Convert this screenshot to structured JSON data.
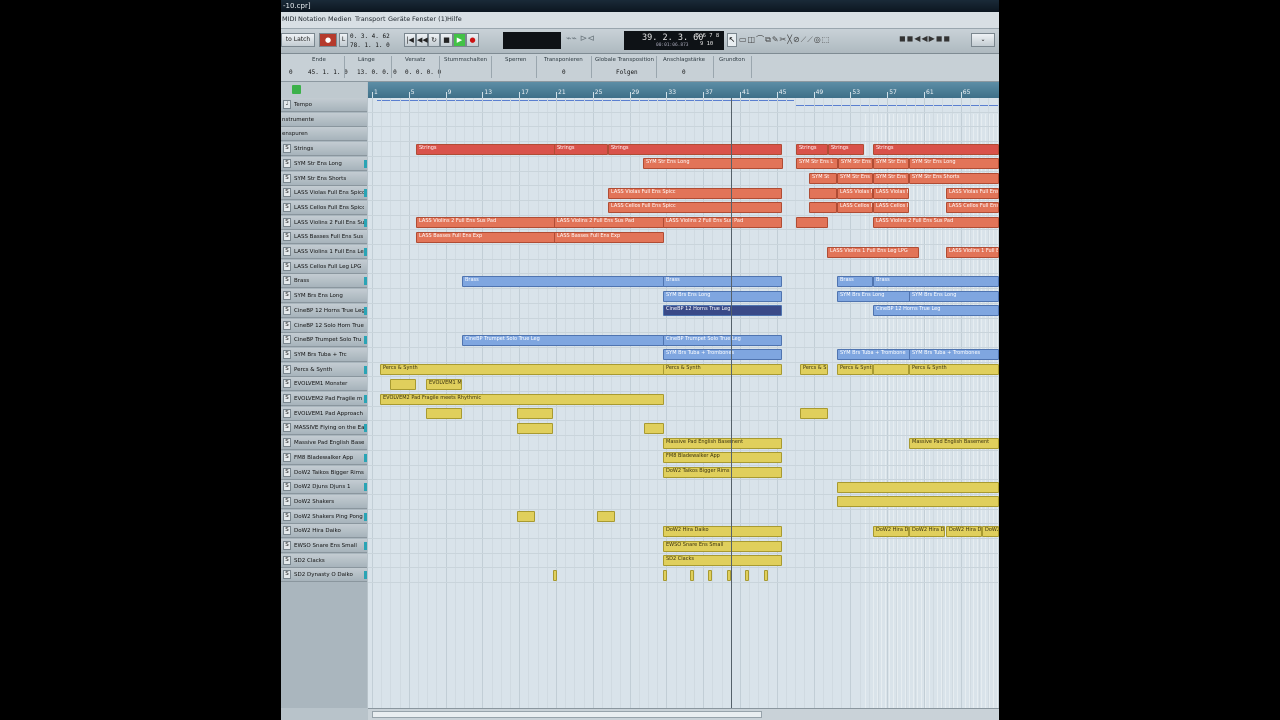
{
  "window_title": "-10.cpr]",
  "menu": [
    "MIDI",
    "Notation",
    "Medien",
    "Transport",
    "Geräte",
    "Fenster (1)",
    "Hilfe"
  ],
  "transport": {
    "mode": "to Latch",
    "loc_left": "0. 3. 4. 62",
    "loc_right": "78. 1. 1. 0",
    "position": "39. 2. 3. 60",
    "position_sub": "00:01:06.873",
    "timesig_top": "5 6 7 8",
    "timesig_bottom": "9 10"
  },
  "info": {
    "labels": [
      "Ende",
      "Länge",
      "Versatz",
      "Stummschalten",
      "Sperren",
      "Transponieren",
      "Globale Transposition",
      "Anschlagstärke",
      "Grundton"
    ],
    "values": [
      "0",
      "45. 1. 1.  0",
      "13. 0. 0.  0",
      "0. 0. 0.  0",
      "",
      "",
      "0",
      "Folgen",
      "0"
    ]
  },
  "colors": {
    "accent": "#5d8ea6",
    "strings": "#e27458",
    "brass": "#7fa6e0",
    "percs": "#e0cf5c"
  },
  "tracks": [
    {
      "name": "Tempo",
      "s": "♩"
    },
    {
      "name": "nstrumente",
      "s": ""
    },
    {
      "name": "enspuren",
      "s": ""
    },
    {
      "name": "Strings",
      "s": "S"
    },
    {
      "name": "SYM Str Ens Long",
      "s": "S"
    },
    {
      "name": "SYM Str Ens Shorts",
      "s": "S"
    },
    {
      "name": "LASS Violas Full Ens Spicc",
      "s": "S"
    },
    {
      "name": "LASS Cellos Full Ens Spicc",
      "s": "S"
    },
    {
      "name": "LASS Violins 2 Full Ens Su",
      "s": "S"
    },
    {
      "name": "LASS Basses Full Ens Sus L",
      "s": "S"
    },
    {
      "name": "LASS Violins 1 Full Ens Le",
      "s": "S"
    },
    {
      "name": "LASS Cellos Full Leg LPG",
      "s": "S"
    },
    {
      "name": "Brass",
      "s": "S"
    },
    {
      "name": "SYM Brs Ens Long",
      "s": "S"
    },
    {
      "name": "CineBP 12 Horns True Leg",
      "s": "S"
    },
    {
      "name": "CineBP 12 Solo Horn True",
      "s": "S"
    },
    {
      "name": "CineBP Trumpet Solo Tru",
      "s": "S"
    },
    {
      "name": "SYM Brs Tuba + Trc",
      "s": "S"
    },
    {
      "name": "Percs & Synth",
      "s": "S"
    },
    {
      "name": "EVOLVEM1 Monster",
      "s": "S"
    },
    {
      "name": "EVOLVEM2 Pad Fragile m",
      "s": "S"
    },
    {
      "name": "EVOLVEM1 Pad Approach",
      "s": "S"
    },
    {
      "name": "MASSIVE Flying on the Ea",
      "s": "S"
    },
    {
      "name": "Massive Pad English Base",
      "s": "S"
    },
    {
      "name": "FM8 Bladewalker App",
      "s": "S"
    },
    {
      "name": "DoW2 Taikos Bigger Rims",
      "s": "S"
    },
    {
      "name": "DoW2 Djuns Djuns 1",
      "s": "S"
    },
    {
      "name": "DoW2 Shakers",
      "s": "S"
    },
    {
      "name": "DoW2 Shakers Ping Pong",
      "s": "S"
    },
    {
      "name": "DoW2 Hira Daiko",
      "s": "S"
    },
    {
      "name": "EWSO Snare Ens Small",
      "s": "S"
    },
    {
      "name": "SD2 Clacks",
      "s": "S"
    },
    {
      "name": "SD2 Dynasty O Daiko",
      "s": "S"
    }
  ],
  "ruler": [
    "1",
    "5",
    "9",
    "13",
    "17",
    "21",
    "25",
    "29",
    "33",
    "37",
    "41",
    "45",
    "49",
    "53",
    "57",
    "61",
    "65"
  ],
  "parts": {
    "strings_1": "Strings",
    "strings_2": "Strings",
    "strings_3": "Strings",
    "strings_4": "Strings",
    "strings_5": "Strings",
    "strings_6": "Strings",
    "symlong_1": "SYM Str Ens Long",
    "symlong_2": "SYM Str Ens L",
    "symlong_3": "SYM Str Ens",
    "symlong_4": "SYM Str Ens",
    "symlong_5": "SYM Str Ens Long",
    "symshort_1": "SYM St",
    "symshort_2": "SYM Str Ens",
    "symshort_3": "SYM Str Ens",
    "symshort_4": "SYM Str Ens Shorts",
    "violas_1": "LASS Violas Full Ens Spicc",
    "violas_2": "LASS Violas F",
    "violas_3": "LASS Violas F",
    "violas_4": "LASS Violas Full Ens",
    "cellos_1": "LASS Cellos Full Ens Spicc",
    "cellos_2": "LASS Cellos F",
    "cellos_3": "LASS Cellos F",
    "cellos_4": "LASS Cellos Full Ens",
    "vln2_1": "LASS Violins 2 Full Ens Sus Pad",
    "vln2_2": "LASS Violins 2 Full Ens Sus Pad",
    "vln2_3": "LASS Violins 2 Full Ens Sus Pad",
    "vln2_4": "LASS Violins 2 Full Ens Sus Pad",
    "bass_1": "LASS Basses Full Ens Exp",
    "bass_2": "LASS Basses Full Ens Exp",
    "vln1_1": "LASS Violins 1 Full Ens Leg LPG",
    "vln1_2": "LASS Violins 1 Full E",
    "brass_1": "Brass",
    "brass_2": "Brass",
    "brass_3": "Brass",
    "brass_4": "Brass",
    "brslong_1": "SYM Brs Ens Long",
    "brslong_2": "SYM Brs Ens Long",
    "brslong_3": "SYM Brs Ens Long",
    "horns_1": "CineBP 12 Horns True Leg",
    "horns_2": "CineBP 12 Horns True Leg",
    "trumpet_1": "CineBP Trumpet Solo True Leg",
    "trumpet_2": "CineBP Trumpet Solo True Leg",
    "tuba_1": "SYM Brs Tuba + Trombones",
    "tuba_2": "SYM Brs Tuba + Trombone",
    "tuba_3": "SYM Brs Tuba + Trombones",
    "percs_1": "Percs & Synth",
    "percs_2": "Percs & Synth",
    "percs_3": "Percs & S",
    "percs_4": "Percs & Synt",
    "percs_5": "Percs & Synth",
    "monster_1": "EVOLVEM1 M",
    "fragile_1": "EVOLVEM2 Pad Fragile meets Rhythmic",
    "english_1": "Massive Pad English Basement",
    "english_2": "Massive Pad English Basement",
    "blade_1": "FM8 Bladewalker App",
    "taikos_1": "DoW2 Taikos Bigger Rims",
    "hira_1": "DoW2 Hira Daiko",
    "hira_2": "DoW2 Hira D",
    "hira_3": "DoW2 Hira D",
    "hira_4": "DoW2 Hira D",
    "hira_5": "DoW2",
    "snare_1": "EWSO Snare Ens Small",
    "clacks_1": "SD2 Clacks"
  }
}
